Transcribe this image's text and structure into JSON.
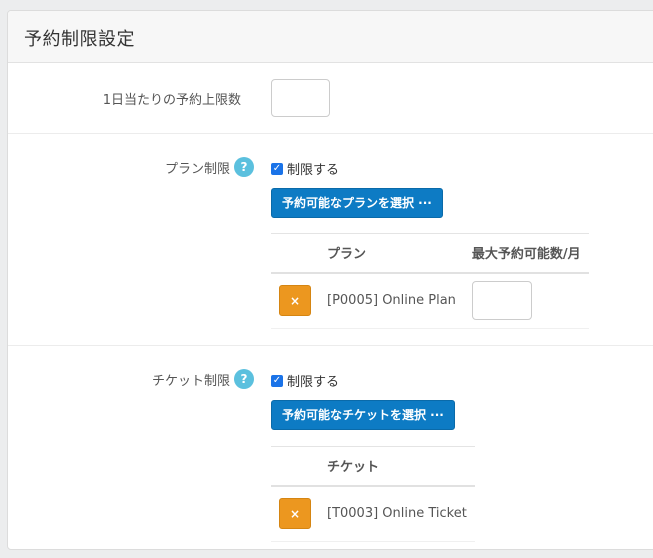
{
  "panel": {
    "title": "予約制限設定"
  },
  "daily_limit": {
    "label": "1日当たりの予約上限数",
    "value": ""
  },
  "plan_limit": {
    "label": "プラン制限",
    "help_icon": "?",
    "checkbox_label": "制限する",
    "checked": true,
    "select_button": "予約可能なプランを選択 ···",
    "columns": [
      "プラン",
      "最大予約可能数/月"
    ],
    "rows": [
      {
        "delete_icon": "×",
        "name": "[P0005] Online Plan",
        "max_value": ""
      }
    ]
  },
  "ticket_limit": {
    "label": "チケット制限",
    "help_icon": "?",
    "checkbox_label": "制限する",
    "checked": true,
    "select_button": "予約可能なチケットを選択 ···",
    "columns": [
      "チケット"
    ],
    "rows": [
      {
        "delete_icon": "×",
        "name": "[T0003] Online Ticket"
      }
    ]
  },
  "colors": {
    "primary": "#0d7bc4",
    "warning": "#ec971f",
    "help": "#5bc0de",
    "checkbox": "#1a73e8"
  }
}
